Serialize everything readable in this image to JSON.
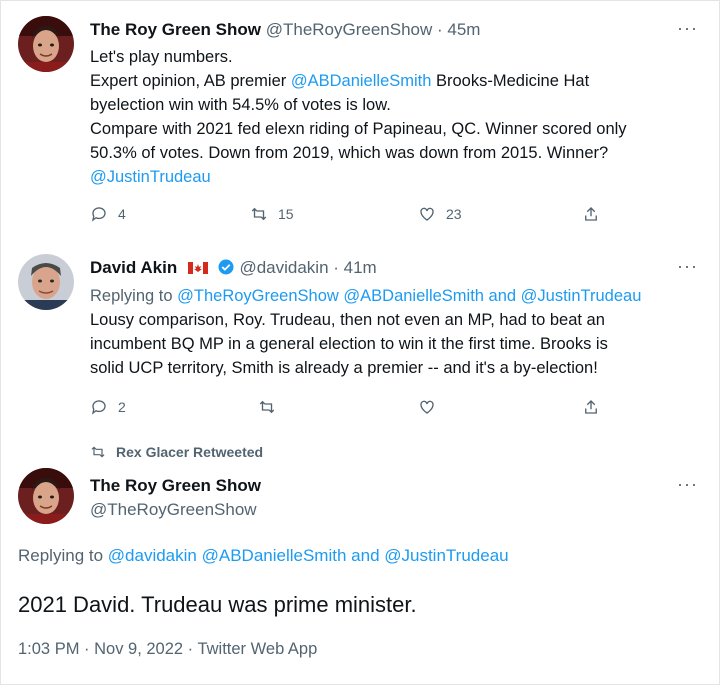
{
  "tweet1": {
    "name": "The Roy Green Show",
    "handle": "@TheRoyGreenShow",
    "time": "· 45m",
    "more": "···",
    "line1": "Let's play numbers.",
    "line2_pre": "Expert opinion, AB premier ",
    "line2_link": "@ABDanielleSmith",
    "line2_post": " Brooks-Medicine Hat",
    "line3": "byelection win with 54.5% of votes is low.",
    "line4": "Compare with 2021 fed elexn riding of Papineau, QC. Winner scored only",
    "line5": "50.3% of votes. Down from 2019, which was down from 2015. Winner?",
    "line6_link": "@JustinTrudeau",
    "replies": "4",
    "retweets": "15",
    "likes": "23"
  },
  "tweet2": {
    "name": "David Akin",
    "handle": "@davidakin",
    "time": "· 41m",
    "more": "···",
    "replying_prefix": "Replying to ",
    "replying_link1": "@TheRoyGreenShow",
    "replying_sep": " ",
    "replying_link2": "@ABDanielleSmith",
    "replying_and": " and ",
    "replying_link3": "@JustinTrudeau",
    "line1": "Lousy comparison, Roy. Trudeau, then not even an MP, had to beat an",
    "line2": "incumbent BQ MP in a general election to win it the first time.  Brooks is",
    "line3": "solid UCP territory, Smith is already a premier -- and it's a by-election!",
    "replies": "2",
    "retweets": "",
    "likes": ""
  },
  "retweet_banner": "Rex Glacer Retweeted",
  "tweet3": {
    "name": "The Roy Green Show",
    "handle": "@TheRoyGreenShow",
    "more": "···",
    "replying_prefix": "Replying to ",
    "replying_link1": "@davidakin",
    "replying_sep": " ",
    "replying_link2": "@ABDanielleSmith",
    "replying_and": " and ",
    "replying_link3": "@JustinTrudeau",
    "text": "2021 David. Trudeau was prime minister.",
    "meta": "1:03 PM · Nov 9, 2022 · Twitter Web App"
  },
  "colors": {
    "link": "#1d9bf0",
    "muted": "#536471",
    "text": "#0f1419",
    "flag_red": "#d52b1e",
    "verified": "#1d9bf0"
  },
  "icons": [
    "reply-icon",
    "retweet-icon",
    "like-icon",
    "share-icon",
    "more-icon",
    "verified-icon",
    "canada-flag-icon"
  ]
}
